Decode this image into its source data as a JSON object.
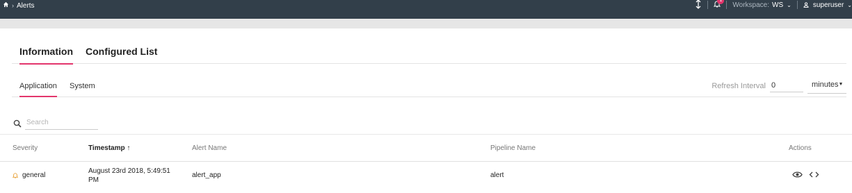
{
  "breadcrumb": {
    "page": "Alerts"
  },
  "topbar": {
    "notification_count": "1",
    "workspace_label": "Workspace:",
    "workspace_value": "WS",
    "user": "superuser"
  },
  "tabs": [
    "Information",
    "Configured List"
  ],
  "subtabs": [
    "Application",
    "System"
  ],
  "refresh": {
    "label": "Refresh Interval",
    "value": "0",
    "unit": "minutes"
  },
  "search": {
    "placeholder": "Search"
  },
  "table": {
    "columns": [
      "Severity",
      "Timestamp",
      "Alert Name",
      "Pipeline Name",
      "Actions"
    ],
    "sort_indicator": "↑",
    "rows": [
      {
        "severity": "general",
        "timestamp_line1": "August 23rd 2018, 5:49:51",
        "timestamp_line2": "PM",
        "alert_name": "alert_app",
        "pipeline_name": "alert"
      }
    ]
  },
  "colors": {
    "topbar": "#323f4a",
    "accent": "#e3356c",
    "warning_icon": "#e8a33c"
  }
}
